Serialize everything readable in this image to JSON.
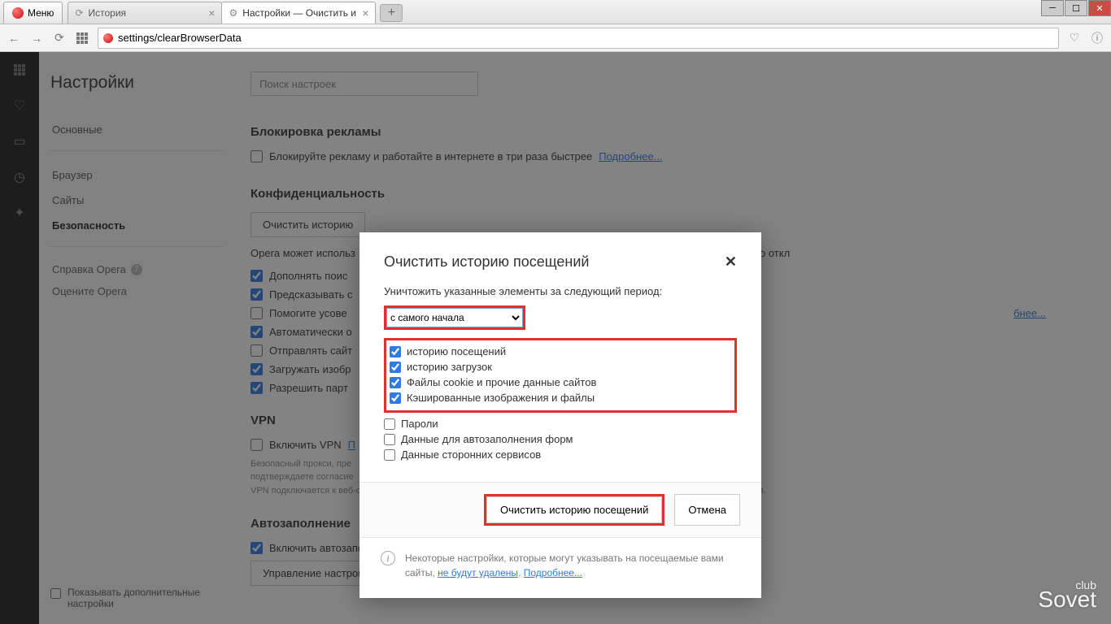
{
  "window": {
    "menu": "Меню"
  },
  "tabs": [
    {
      "label": "История",
      "icon": "history"
    },
    {
      "label": "Настройки — Очистить и",
      "icon": "settings"
    }
  ],
  "url": "settings/clearBrowserData",
  "sidebar": {
    "title": "Настройки",
    "items": [
      "Основные",
      "Браузер",
      "Сайты",
      "Безопасность"
    ],
    "help": "Справка Opera",
    "rate": "Оцените Opera",
    "show_advanced": "Показывать дополнительные настройки"
  },
  "search_placeholder": "Поиск настроек",
  "sections": {
    "ads": {
      "title": "Блокировка рекламы",
      "option": "Блокируйте рекламу и работайте в интернете в три раза быстрее",
      "more": "Подробнее..."
    },
    "privacy": {
      "title": "Конфиденциальность",
      "clear_btn": "Очистить историю",
      "hint_pre": "Opera может использ",
      "hint_post": "ости эти службы можно откл",
      "opts": [
        "Дополнять поис",
        "Предсказывать с",
        "Помогите усове",
        "Автоматически о",
        "Отправлять сайт",
        "Загружать изобр",
        "Разрешить парт"
      ],
      "more": "бнее..."
    },
    "vpn": {
      "title": "VPN",
      "enable": "Включить VPN",
      "link": "П",
      "fine1": "Безопасный прокси, пре",
      "fine2": "подтверждаете согласие",
      "fine3": "VPN подключается к веб-сайтам через различные серверы по всему миру, что может отразиться на скорости подключения."
    },
    "autofill": {
      "title": "Автозаполнение",
      "enable": "Включить автозаполнение форм на страницах",
      "manage": "Управление настройками автозаполнения"
    }
  },
  "dialog": {
    "title": "Очистить историю посещений",
    "destroy_label": "Уничтожить указанные элементы за следующий период:",
    "period": "с самого начала",
    "checks": [
      {
        "label": "историю посещений",
        "checked": true
      },
      {
        "label": "историю загрузок",
        "checked": true
      },
      {
        "label": "Файлы cookie и прочие данные сайтов",
        "checked": true
      },
      {
        "label": "Кэшированные изображения и файлы",
        "checked": true
      }
    ],
    "unchecked": [
      "Пароли",
      "Данные для автозаполнения форм",
      "Данные сторонних сервисов"
    ],
    "confirm": "Очистить историю посещений",
    "cancel": "Отмена",
    "note_pre": "Некоторые настройки, которые могут указывать на посещаемые вами сайты, ",
    "note_link1": "не будут удалены",
    "note_sep": ". ",
    "note_link2": "Подробнее..."
  },
  "watermark": {
    "small": "club",
    "big": "Sovet"
  }
}
